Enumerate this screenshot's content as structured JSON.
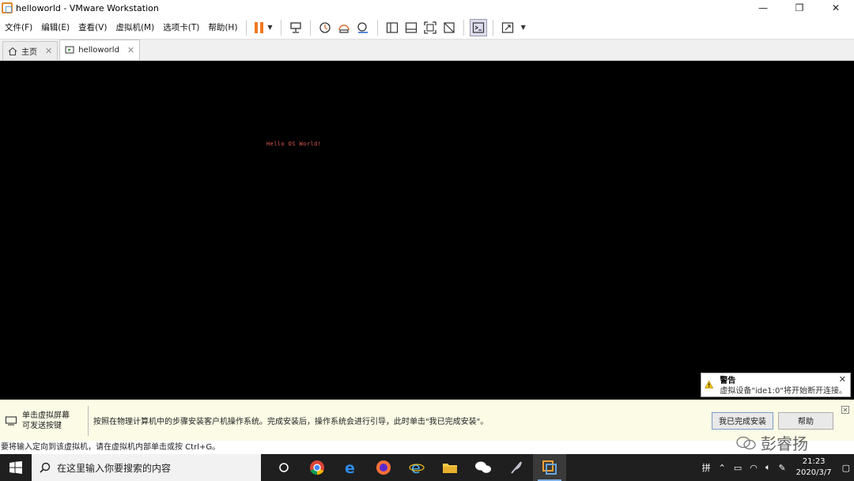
{
  "window": {
    "title": "helloworld - VMware Workstation"
  },
  "menu": [
    "文件(F)",
    "编辑(E)",
    "查看(V)",
    "虚拟机(M)",
    "选项卡(T)",
    "帮助(H)"
  ],
  "tabs": [
    {
      "label": "主页",
      "icon": "home-icon"
    },
    {
      "label": "helloworld",
      "icon": "vm-icon"
    }
  ],
  "vm": {
    "console_text": "Hello OS World!"
  },
  "toast": {
    "title": "警告",
    "message": "虚拟设备\"ide1:0\"将开始断开连接。"
  },
  "install_bar": {
    "left_text": "单击虚拟屏幕可发送按键",
    "left_line1": "单击虚拟屏幕",
    "left_line2": "可发送按键",
    "message": "按照在物理计算机中的步骤安装客户机操作系统。完成安装后，操作系统会进行引导，此时单击\"我已完成安装\"。",
    "done_button": "我已完成安装",
    "help_button": "帮助"
  },
  "statusbar": {
    "text": "要将输入定向到该虚拟机，请在虚拟机内部单击或按 Ctrl+G。"
  },
  "watermark": {
    "text": "彭睿扬"
  },
  "taskbar": {
    "search_placeholder": "在这里输入你要搜索的内容",
    "ime": "拼",
    "time": "21:23",
    "date": "2020/3/7"
  },
  "colors": {
    "accent_orange": "#f07820",
    "console_text": "#e05a52",
    "taskbar": "#1f1f1f"
  }
}
